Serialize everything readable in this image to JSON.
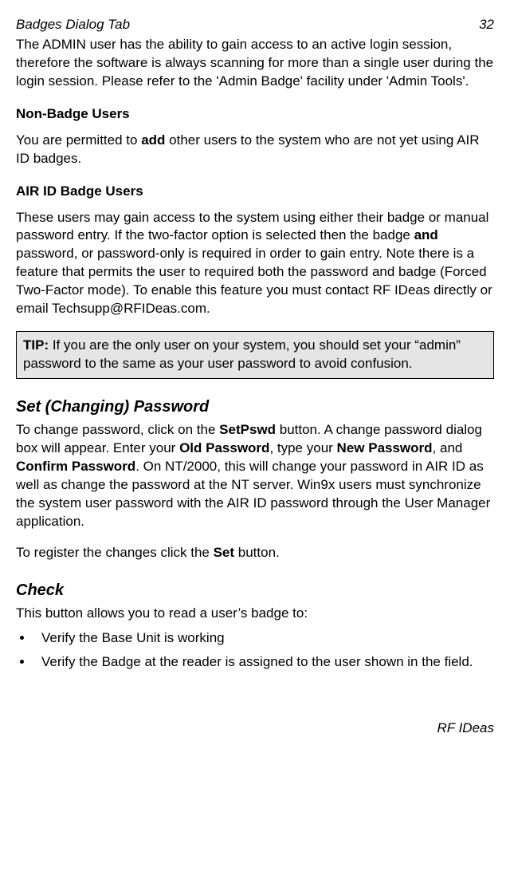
{
  "header": {
    "title": "Badges Dialog Tab",
    "page": "32"
  },
  "intro": {
    "text": "The ADMIN user has the ability to gain access to an active login session, therefore the software is always scanning for more than a single user during the login session.  Please refer to the 'Admin Badge' facility under 'Admin Tools'."
  },
  "nonBadge": {
    "heading": "Non-Badge Users",
    "p1a": "You are permitted to ",
    "p1b": "add",
    "p1c": " other users to the system who are not yet using AIR ID badges."
  },
  "airId": {
    "heading": "AIR ID Badge Users",
    "p1a": "These users may gain access to the system using either their badge or manual password entry.  If the two-factor option is selected then the badge ",
    "p1b": "and",
    "p1c": " password, or password-only is required in order to gain entry.  Note there is a feature that permits the user to required both the password and badge (Forced Two-Factor mode).  To enable this feature you must contact RF IDeas directly or email Techsupp@RFIDeas.com."
  },
  "tip": {
    "label": "TIP:",
    "text": " If you are the only user on your system, you should set your “admin” password to the same as your user password to avoid confusion."
  },
  "setPassword": {
    "heading": "Set (Changing) Password",
    "p1a": "To change password, click on the ",
    "p1b": "SetPswd",
    "p1c": " button. A change password dialog box will appear. Enter your ",
    "p1d": "Old Password",
    "p1e": ", type your ",
    "p1f": "New Password",
    "p1g": ", and ",
    "p1h": "Confirm Password",
    "p1i": ".  On NT/2000, this will change your password in AIR ID as well as change the password at the NT server.  Win9x users must synchronize the system user password with the AIR ID password through the User Manager application.",
    "p2a": "To register the changes click the ",
    "p2b": "Set",
    "p2c": " button."
  },
  "check": {
    "heading": "Check",
    "intro": "This button allows you to read a user’s badge to:",
    "items": {
      "0": "Verify the Base Unit is working",
      "1": "Verify the Badge at the reader is assigned to the user shown in the field."
    }
  },
  "footer": {
    "text": "RF IDeas"
  }
}
